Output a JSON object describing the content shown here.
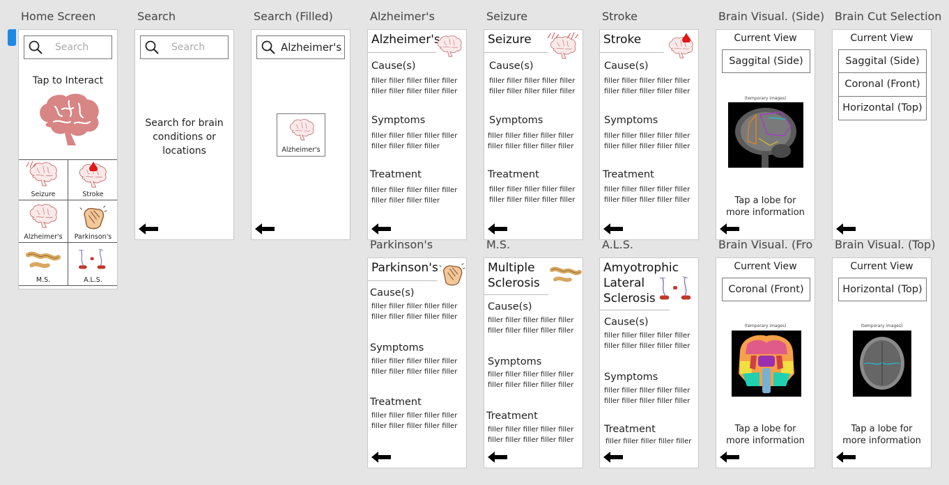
{
  "frames": {
    "home": {
      "label": "Home Screen",
      "search_placeholder": "Search",
      "tap_text": "Tap to Interact",
      "grid": [
        {
          "label": "Seizure",
          "icon": "brain-pulse-icon"
        },
        {
          "label": "Stroke",
          "icon": "brain-blood-drop-icon"
        },
        {
          "label": "Alzheimer's",
          "icon": "brain-icon"
        },
        {
          "label": "Parkinson's",
          "icon": "shaking-hand-icon"
        },
        {
          "label": "M.S.",
          "icon": "nerve-icon"
        },
        {
          "label": "A.L.S.",
          "icon": "neuron-icon"
        }
      ]
    },
    "search": {
      "label": "Search",
      "search_placeholder": "Search",
      "helper": "Search for brain conditions or locations"
    },
    "search_filled": {
      "label": "Search (Filled)",
      "query": "Alzheimer's",
      "result_label": "Alzheimer's"
    },
    "alzheimers": {
      "label": "Alzheimer's",
      "title": "Alzheimer's"
    },
    "seizure": {
      "label": "Seizure",
      "title": "Seizure"
    },
    "stroke": {
      "label": "Stroke",
      "title": "Stroke"
    },
    "brain_side": {
      "label": "Brain Visual. (Side)",
      "current_view": "Current View",
      "view": "Saggital (Side)",
      "tmp": "(temporary images)",
      "tap": "Tap a lobe for more information"
    },
    "brain_cut": {
      "label": "Brain Cut Selection",
      "current_view": "Current View",
      "options": [
        "Saggital (Side)",
        "Coronal (Front)",
        "Horizontal (Top)"
      ]
    },
    "parkinsons": {
      "label": "Parkinson's",
      "title": "Parkinson's"
    },
    "ms": {
      "label": "M.S.",
      "title": "Multiple Sclerosis"
    },
    "als": {
      "label": "A.L.S.",
      "title": "Amyotrophic Lateral Sclerosis"
    },
    "brain_front": {
      "label": "Brain Visual. (Fro...",
      "current_view": "Current View",
      "view": "Coronal (Front)",
      "tmp": "(temporary images)",
      "tap": "Tap a lobe for more information"
    },
    "brain_top": {
      "label": "Brain Visual. (Top)",
      "current_view": "Current View",
      "view": "Horizontal (Top)",
      "tmp": "(temporary images)",
      "tap": "Tap a lobe for more information"
    }
  },
  "sections": {
    "cause": "Cause(s)",
    "symptoms": "Symptoms",
    "treatment": "Treatment"
  },
  "filler": {
    "line": "filler filler filler filler filler",
    "line_short": "filler filler filler filler"
  },
  "colors": {
    "brain": "#d88585",
    "brain_dark": "#b86060",
    "blood": "#e01818",
    "accent": "#1e88e5"
  }
}
